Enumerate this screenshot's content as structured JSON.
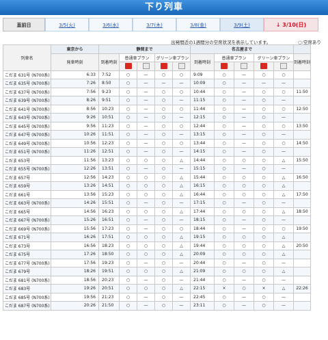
{
  "title": "下り列車",
  "tabs": [
    {
      "label": "直前日",
      "kind": "current"
    },
    {
      "label": "3/5(火)",
      "kind": "weekday"
    },
    {
      "label": "3/6(水)",
      "kind": "weekday"
    },
    {
      "label": "3/7(木)",
      "kind": "weekday"
    },
    {
      "label": "3/8(金)",
      "kind": "weekday"
    },
    {
      "label": "3/9(土)",
      "kind": "sat"
    },
    {
      "label": "↓ 3/10(日)",
      "kind": "sun"
    }
  ],
  "note": "出発間近の1週間分の空席状況を表示しています。",
  "legend": "○:空席あり",
  "headers": {
    "train_name": "列車名",
    "tokyo": "東京から",
    "departure_time": "発車時刻",
    "shizuoka": "静岡まで",
    "nagoya": "名古屋まで",
    "arrival_time": "到着時刻",
    "normal_plan": "普通車プラン",
    "green_plan": "グリーン車プラン",
    "arrival_time_next": "到着時刻"
  },
  "rows": [
    {
      "name": "こだま 631号 (N700系)",
      "dep": "6:33",
      "shz": "7:52",
      "s": [
        "○",
        "—",
        "○",
        "○"
      ],
      "ngy": "9:09",
      "n": [
        "○",
        "—",
        "○",
        "○"
      ],
      "x": ""
    },
    {
      "name": "こだま 635号 (N700系)",
      "dep": "7:26",
      "shz": "8:50",
      "s": [
        "○",
        "—",
        "—",
        "—"
      ],
      "ngy": "10:09",
      "n": [
        "○",
        "—",
        "—",
        "—"
      ],
      "x": ""
    },
    {
      "name": "こだま 637号 (N700系)",
      "dep": "7:56",
      "shz": "9:23",
      "s": [
        "○",
        "—",
        "○",
        "○"
      ],
      "ngy": "10:44",
      "n": [
        "○",
        "—",
        "○",
        "○"
      ],
      "x": "11:50"
    },
    {
      "name": "こだま 639号 (N700系)",
      "dep": "8:26",
      "shz": "9:51",
      "s": [
        "○",
        "—",
        "○",
        "—"
      ],
      "ngy": "11:15",
      "n": [
        "○",
        "—",
        "○",
        "—"
      ],
      "x": ""
    },
    {
      "name": "こだま 641号 (N700系)",
      "dep": "8:56",
      "shz": "10:23",
      "s": [
        "○",
        "—",
        "○",
        "○"
      ],
      "ngy": "11:44",
      "n": [
        "○",
        "—",
        "○",
        "○"
      ],
      "x": "12:50"
    },
    {
      "name": "こだま 643号 (N700系)",
      "dep": "9:26",
      "shz": "10:51",
      "s": [
        "○",
        "—",
        "○",
        "—"
      ],
      "ngy": "12:15",
      "n": [
        "○",
        "—",
        "○",
        "—"
      ],
      "x": ""
    },
    {
      "name": "こだま 645号 (N700系)",
      "dep": "9:56",
      "shz": "11:23",
      "s": [
        "○",
        "—",
        "○",
        "○"
      ],
      "ngy": "12:44",
      "n": [
        "○",
        "—",
        "○",
        "○"
      ],
      "x": "13:50"
    },
    {
      "name": "こだま 647号 (N700系)",
      "dep": "10:26",
      "shz": "11:51",
      "s": [
        "○",
        "—",
        "○",
        "—"
      ],
      "ngy": "13:15",
      "n": [
        "○",
        "—",
        "○",
        "—"
      ],
      "x": ""
    },
    {
      "name": "こだま 649号 (N700系)",
      "dep": "10:56",
      "shz": "12:23",
      "s": [
        "○",
        "—",
        "○",
        "○"
      ],
      "ngy": "13:44",
      "n": [
        "○",
        "—",
        "○",
        "○"
      ],
      "x": "14:50"
    },
    {
      "name": "こだま 651号 (N700系)",
      "dep": "11:26",
      "shz": "12:51",
      "s": [
        "○",
        "—",
        "○",
        "—"
      ],
      "ngy": "14:15",
      "n": [
        "○",
        "—",
        "○",
        "—"
      ],
      "x": ""
    },
    {
      "name": "こだま 653号",
      "dep": "11:56",
      "shz": "13:23",
      "s": [
        "○",
        "○",
        "○",
        "△"
      ],
      "ngy": "14:44",
      "n": [
        "○",
        "○",
        "○",
        "△"
      ],
      "x": "15:50"
    },
    {
      "name": "こだま 655号 (N700系)",
      "dep": "12:26",
      "shz": "13:51",
      "s": [
        "○",
        "—",
        "○",
        "—"
      ],
      "ngy": "15:15",
      "n": [
        "○",
        "—",
        "○",
        "—"
      ],
      "x": ""
    },
    {
      "name": "こだま 657号",
      "dep": "12:56",
      "shz": "14:23",
      "s": [
        "○",
        "○",
        "○",
        "△"
      ],
      "ngy": "15:44",
      "n": [
        "○",
        "○",
        "○",
        "△"
      ],
      "x": "16:50"
    },
    {
      "name": "こだま 659号",
      "dep": "13:26",
      "shz": "14:51",
      "s": [
        "○",
        "○",
        "○",
        "△"
      ],
      "ngy": "16:15",
      "n": [
        "○",
        "○",
        "○",
        "△"
      ],
      "x": ""
    },
    {
      "name": "こだま 661号",
      "dep": "13:56",
      "shz": "15:23",
      "s": [
        "○",
        "○",
        "○",
        "△"
      ],
      "ngy": "16:44",
      "n": [
        "○",
        "○",
        "○",
        "△"
      ],
      "x": "17:50"
    },
    {
      "name": "こだま 663号 (N700系)",
      "dep": "14:26",
      "shz": "15:51",
      "s": [
        "○",
        "—",
        "○",
        "—"
      ],
      "ngy": "17:15",
      "n": [
        "○",
        "—",
        "○",
        "—"
      ],
      "x": ""
    },
    {
      "name": "こだま 665号",
      "dep": "14:56",
      "shz": "16:23",
      "s": [
        "○",
        "○",
        "○",
        "△"
      ],
      "ngy": "17:44",
      "n": [
        "○",
        "○",
        "○",
        "△"
      ],
      "x": "18:50"
    },
    {
      "name": "こだま 667号 (N700系)",
      "dep": "15:26",
      "shz": "16:51",
      "s": [
        "○",
        "—",
        "○",
        "—"
      ],
      "ngy": "18:15",
      "n": [
        "○",
        "—",
        "○",
        "—"
      ],
      "x": ""
    },
    {
      "name": "こだま 669号 (N700系)",
      "dep": "15:56",
      "shz": "17:23",
      "s": [
        "○",
        "—",
        "○",
        "○"
      ],
      "ngy": "18:44",
      "n": [
        "○",
        "—",
        "○",
        "○"
      ],
      "x": "19:50"
    },
    {
      "name": "こだま 671号",
      "dep": "16:26",
      "shz": "17:51",
      "s": [
        "○",
        "○",
        "○",
        "△"
      ],
      "ngy": "19:15",
      "n": [
        "○",
        "○",
        "○",
        "△"
      ],
      "x": ""
    },
    {
      "name": "こだま 673号",
      "dep": "16:56",
      "shz": "18:23",
      "s": [
        "○",
        "○",
        "○",
        "△"
      ],
      "ngy": "19:44",
      "n": [
        "○",
        "○",
        "○",
        "△"
      ],
      "x": "20:50"
    },
    {
      "name": "こだま 675号",
      "dep": "17:26",
      "shz": "18:50",
      "s": [
        "○",
        "○",
        "○",
        "△"
      ],
      "ngy": "20:09",
      "n": [
        "○",
        "○",
        "○",
        "△"
      ],
      "x": ""
    },
    {
      "name": "こだま 677号 (N700系)",
      "dep": "17:56",
      "shz": "19:23",
      "s": [
        "○",
        "—",
        "○",
        "—"
      ],
      "ngy": "20:44",
      "n": [
        "○",
        "—",
        "○",
        "—"
      ],
      "x": ""
    },
    {
      "name": "こだま 679号",
      "dep": "18:26",
      "shz": "19:51",
      "s": [
        "○",
        "○",
        "○",
        "△"
      ],
      "ngy": "21:09",
      "n": [
        "○",
        "○",
        "○",
        "△"
      ],
      "x": ""
    },
    {
      "name": "こだま 681号 (N700系)",
      "dep": "18:56",
      "shz": "20:23",
      "s": [
        "○",
        "—",
        "○",
        "—"
      ],
      "ngy": "21:44",
      "n": [
        "○",
        "—",
        "○",
        "—"
      ],
      "x": ""
    },
    {
      "name": "こだま 683号",
      "dep": "19:26",
      "shz": "20:51",
      "s": [
        "○",
        "○",
        "○",
        "△"
      ],
      "ngy": "22:15",
      "n": [
        "×",
        "○",
        "×",
        "△"
      ],
      "x": "22:26"
    },
    {
      "name": "こだま 685号 (N700系)",
      "dep": "19:56",
      "shz": "21:23",
      "s": [
        "○",
        "—",
        "○",
        "—"
      ],
      "ngy": "22:45",
      "n": [
        "○",
        "—",
        "○",
        "—"
      ],
      "x": ""
    },
    {
      "name": "こだま 687号 (N700系)",
      "dep": "20:26",
      "shz": "21:50",
      "s": [
        "○",
        "—",
        "○",
        "—"
      ],
      "ngy": "23:11",
      "n": [
        "○",
        "—",
        "○",
        "—"
      ],
      "x": ""
    }
  ]
}
